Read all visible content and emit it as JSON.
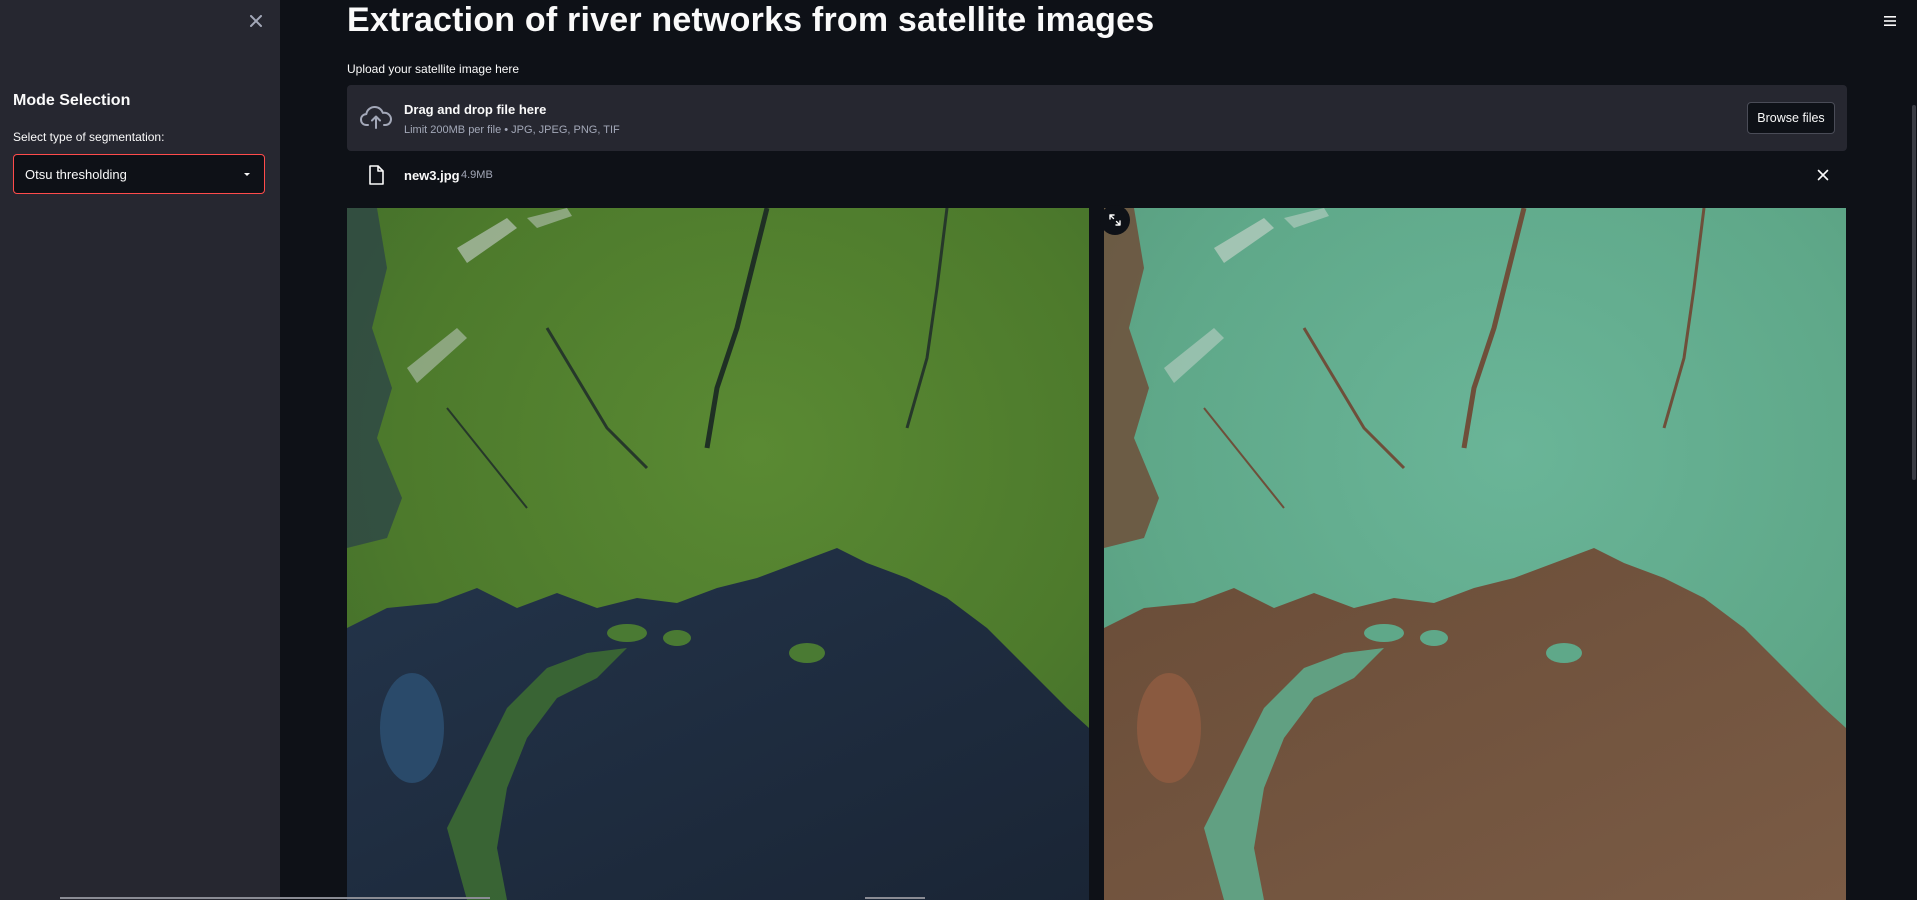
{
  "sidebar": {
    "title": "Mode Selection",
    "select_label": "Select type of segmentation:",
    "select_value": "Otsu thresholding"
  },
  "main": {
    "title": "Extraction of river networks from satellite images",
    "upload_label": "Upload your satellite image here",
    "dropzone": {
      "title": "Drag and drop file here",
      "subtitle": "Limit 200MB per file • JPG, JPEG, PNG, TIF",
      "browse_label": "Browse files"
    },
    "file": {
      "name": "new3.jpg",
      "size": "4.9MB"
    }
  },
  "colors": {
    "background": "#0e1117",
    "sidebar": "#262730",
    "accent": "#ff4b4b",
    "land_original": "#4f7a2e",
    "water_original": "#1d2b3d",
    "land_segmented": "#5fa889",
    "water_segmented": "#6e4f3a"
  },
  "icons": {
    "sidebar_close": "close-icon",
    "menu": "hamburger-icon",
    "upload": "cloud-upload-icon",
    "file": "file-icon",
    "remove": "close-icon",
    "expand": "fullscreen-icon",
    "select_caret": "caret-down-icon"
  }
}
